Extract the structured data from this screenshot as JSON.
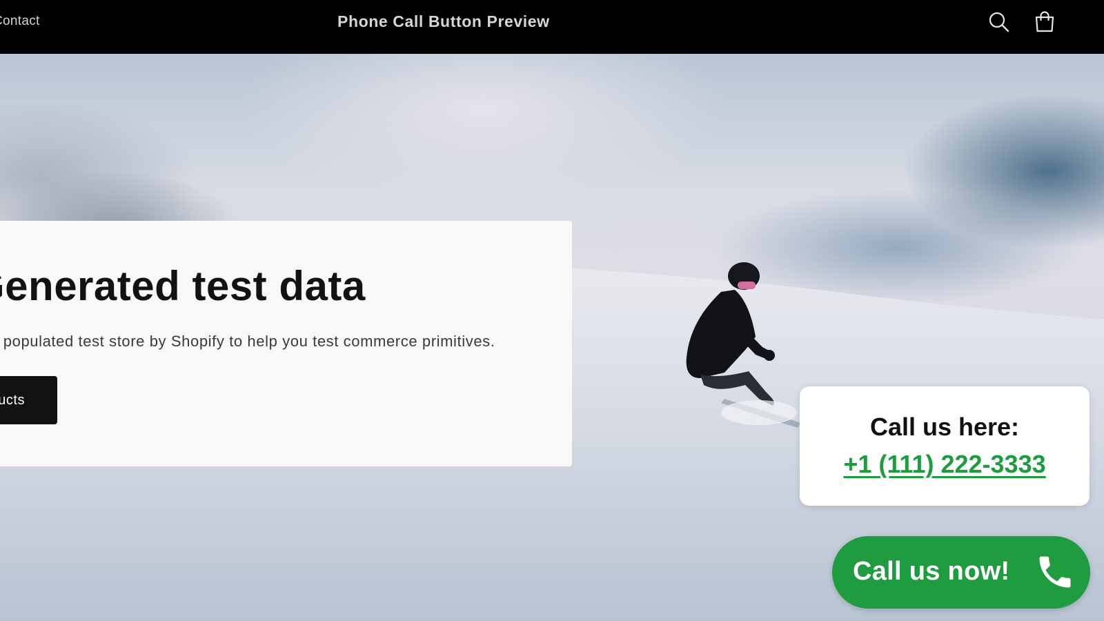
{
  "header": {
    "nav_link": "Contact",
    "store_title": "Phone Call Button Preview",
    "search_icon": "search-icon",
    "cart_icon": "cart-icon"
  },
  "hero": {
    "heading": "Generated test data",
    "subheading": "A populated test store by Shopify to help you test commerce primitives.",
    "button_label": "Products"
  },
  "call_card": {
    "heading": "Call us here:",
    "phone": "+1 (111) 222-3333"
  },
  "call_button": {
    "label": "Call us now!",
    "icon": "phone-icon"
  },
  "colors": {
    "header_bg": "#000000",
    "accent_green": "#1f9b40",
    "phone_link_green": "#1e9c3e",
    "panel_bg": "#f9f8f6",
    "button_bg": "#121212"
  }
}
